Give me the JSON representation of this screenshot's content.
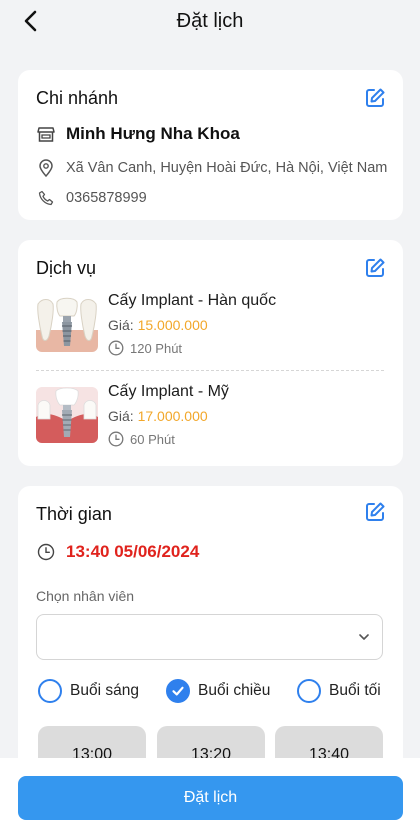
{
  "header": {
    "title": "Đặt lịch",
    "back_icon": "chevron-left-icon"
  },
  "branch": {
    "title": "Chi nhánh",
    "name": "Minh Hưng Nha Khoa",
    "address": "Xã Vân Canh, Huyện Hoài Đức, Hà Nội, Việt Nam",
    "phone": "0365878999",
    "icons": [
      "store-icon",
      "location-pin-icon",
      "phone-icon",
      "edit-icon"
    ]
  },
  "services": {
    "title": "Dịch vụ",
    "price_label": "Giá: ",
    "items": [
      {
        "name": "Cấy Implant - Hàn quốc",
        "price": "15.000.000",
        "duration": "120 Phút"
      },
      {
        "name": "Cấy Implant - Mỹ",
        "price": "17.000.000",
        "duration": "60 Phút"
      }
    ]
  },
  "time": {
    "title": "Thời gian",
    "datetime": "13:40 05/06/2024",
    "staff_label": "Chọn nhân viên",
    "staff_value": "",
    "sessions": [
      {
        "label": "Buổi sáng",
        "checked": false
      },
      {
        "label": "Buổi chiều",
        "checked": true
      },
      {
        "label": "Buổi tối",
        "checked": false
      }
    ],
    "slots": [
      "13:00",
      "13:20",
      "13:40"
    ]
  },
  "footer": {
    "book_label": "Đặt lịch"
  },
  "colors": {
    "accent": "#2f80ed",
    "button": "#3597ef",
    "price": "#f2a72a",
    "datetime": "#e0231d",
    "background": "#f2f3f5"
  }
}
